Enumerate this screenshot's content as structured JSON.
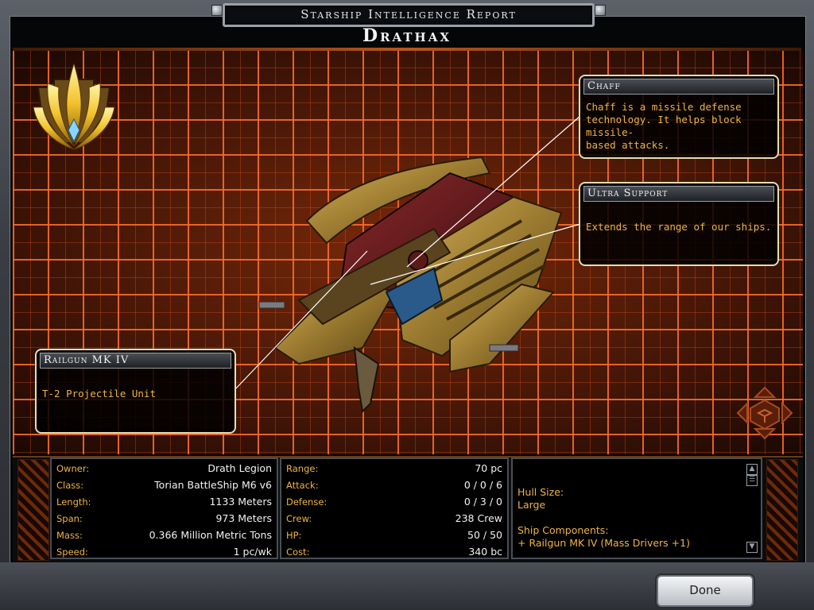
{
  "window": {
    "title": "Starship Intelligence Report"
  },
  "ship": {
    "name": "Drathax"
  },
  "callouts": {
    "chaff": {
      "title": "Chaff",
      "lines": [
        "Chaff is a missile defense",
        "technology. It helps block missile-",
        "based attacks."
      ]
    },
    "ultra_support": {
      "title": "Ultra Support",
      "lines": [
        "Extends the range of our ships."
      ]
    },
    "railgun": {
      "title": "Railgun MK IV",
      "lines": [
        "T-2 Projectile Unit"
      ]
    }
  },
  "specs_left": [
    {
      "label": "Owner:",
      "value": "Drath Legion"
    },
    {
      "label": "Class:",
      "value": "Torian BattleShip M6 v6"
    },
    {
      "label": "Length:",
      "value": "1133 Meters"
    },
    {
      "label": "Span:",
      "value": "973 Meters"
    },
    {
      "label": "Mass:",
      "value": "0.366 Million Metric Tons"
    },
    {
      "label": "Speed:",
      "value": "1 pc/wk"
    }
  ],
  "specs_right": [
    {
      "label": "Range:",
      "value": "70 pc"
    },
    {
      "label": "Attack:",
      "value": "0 / 0 / 6"
    },
    {
      "label": "Defense:",
      "value": "0 / 3 / 0"
    },
    {
      "label": "Crew:",
      "value": "238 Crew"
    },
    {
      "label": "HP:",
      "value": "50 / 50"
    },
    {
      "label": "Cost:",
      "value": "340 bc"
    }
  ],
  "description": {
    "hull_size_label": "Hull Size:",
    "hull_size_value": "Large",
    "components_label": "Ship Components:",
    "components": [
      "+ Railgun MK IV (Mass Drivers +1)"
    ]
  },
  "buttons": {
    "done": "Done"
  },
  "icons": {
    "emblem": "drath-faction-emblem-icon",
    "rotate": "rotate-view-icon",
    "scroll_up": "scroll-up-icon",
    "scroll_down": "scroll-down-icon"
  },
  "colors": {
    "accent_text": "#f0b440",
    "grid_line": "#ff6e28",
    "grid_bg": "#351307"
  }
}
